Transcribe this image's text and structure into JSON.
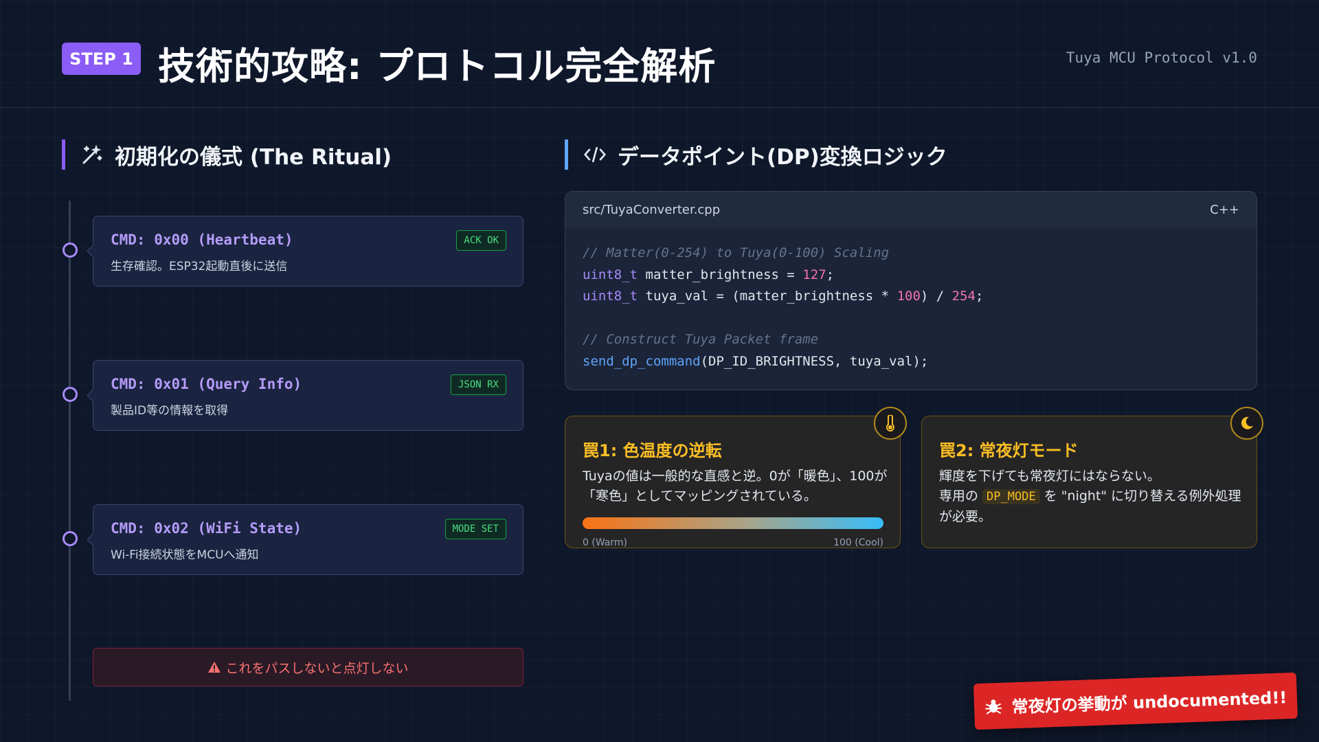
{
  "header": {
    "step": "STEP 1",
    "title": "技術的攻略: プロトコル完全解析",
    "version": "Tuya MCU Protocol v1.0"
  },
  "ritual": {
    "heading": "初期化の儀式 (The Ritual)",
    "icon": "magic-wand-icon",
    "commands": [
      {
        "title": "CMD: 0x00 (Heartbeat)",
        "desc": "生存確認。ESP32起動直後に送信",
        "badge": "ACK OK"
      },
      {
        "title": "CMD: 0x01 (Query Info)",
        "desc": "製品ID等の情報を取得",
        "badge": "JSON RX"
      },
      {
        "title": "CMD: 0x02 (WiFi State)",
        "desc": "Wi-Fi接続状態をMCUへ通知",
        "badge": "MODE SET"
      }
    ],
    "warning": "これをパスしないと点灯しない",
    "warning_icon": "warning-triangle-icon"
  },
  "dp_logic": {
    "heading": "データポイント(DP)変換ロジック",
    "icon": "code-icon",
    "file": "src/TuyaConverter.cpp",
    "lang": "C++",
    "code": {
      "comment1": "// Matter(0-254) to Tuya(0-100) Scaling",
      "l2_type": "uint8_t",
      "l2_rest": " matter_brightness = ",
      "l2_num": "127",
      "l2_end": ";",
      "l3_type": "uint8_t",
      "l3_rest": " tuya_val = (matter_brightness * ",
      "l3_num1": "100",
      "l3_mid": ") / ",
      "l3_num2": "254",
      "l3_end": ";",
      "comment2": "// Construct Tuya Packet frame",
      "l6_fn": "send_dp_command",
      "l6_rest": "(DP_ID_BRIGHTNESS, tuya_val);"
    }
  },
  "traps": [
    {
      "title": "罠1: 色温度の逆転",
      "icon": "thermometer-icon",
      "text": "Tuyaの値は一般的な直感と逆。0が「暖色」、100が「寒色」としてマッピングされている。",
      "scale_left": "0 (Warm)",
      "scale_right": "100 (Cool)"
    },
    {
      "title": "罠2: 常夜灯モード",
      "icon": "moon-icon",
      "text_line1": "輝度を下げても常夜灯にはならない。",
      "text_pre": "専用の ",
      "text_code": "DP_MODE",
      "text_post": " を \"night\" に切り替える例外処理が必要。"
    }
  ],
  "banner": {
    "text": "常夜灯の挙動が undocumented!!",
    "icon": "bug-icon"
  },
  "colors": {
    "accent_purple": "#8b5cf6",
    "accent_blue": "#60a5fa",
    "warning_amber": "#fbbf24",
    "danger_red": "#dc2626",
    "success_green": "#4ade80"
  }
}
